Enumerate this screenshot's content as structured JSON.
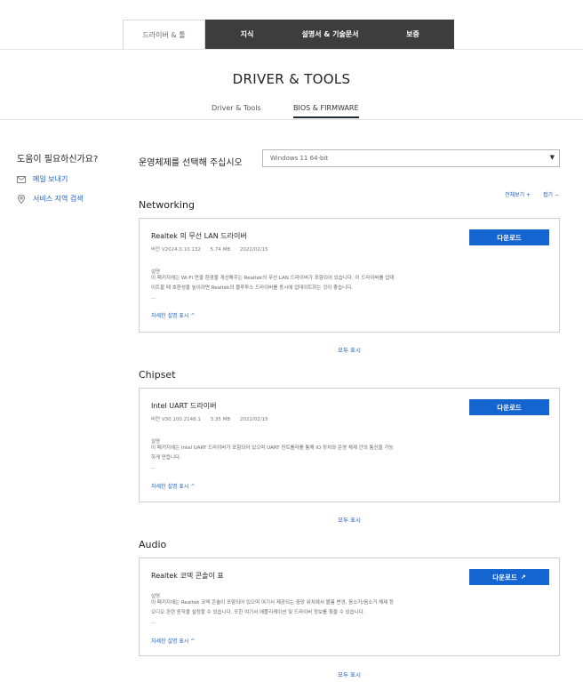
{
  "top_tabs": [
    "드라이버 & 툴",
    "지식",
    "설명서 & 기술문서",
    "보증"
  ],
  "page_title": "DRIVER & TOOLS",
  "sub_tabs": [
    "Driver & Tools",
    "BIOS & FIRMWARE"
  ],
  "help": {
    "title": "도움이 필요하신가요?",
    "email": "메일 보내기",
    "service_area": "서비스 지역 검색"
  },
  "os": {
    "label": "운영체제를 선택해 주십시오",
    "selected": "Windows 11 64-bit"
  },
  "expand_all": "전체보기 +",
  "collapse_all": "접기 −",
  "show_all": "모두 표시",
  "more_label": "자세한 설명 표시 ^",
  "desc_label": "설명",
  "ellipsis": "...",
  "sections": [
    {
      "title": "Networking",
      "item": {
        "name": "Realtek 의 무선 LAN 드라이버",
        "version": "버전 V2024.0.10.132",
        "size": "5.74 MB",
        "date": "2022/02/15",
        "desc_line1": "이 패키지에는 Wi-Fi 연결 환경을 개선해주는 Realtek의 무선 LAN 드라이버가 포함되어 있습니다. 이 드라이버를 업데",
        "desc_line2": "이트할 때 호환성을 높이려면 Realtek의 블루투스 드라이버를 동시에 업데이트하는 것이 좋습니다.",
        "button": "다운로드",
        "external": false
      }
    },
    {
      "title": "Chipset",
      "item": {
        "name": "Intel UART 드라이버",
        "version": "버전 V30.100.2148.1",
        "size": "3.35 MB",
        "date": "2022/02/15",
        "desc_line1": "이 패키지에는 Intel UART 드라이버가 포함되어 있으며 UART 컨트롤러를 통해 IO 장치와 운영 체제 간의 통신을 가능",
        "desc_line2": "하게 만듭니다.",
        "button": "다운로드",
        "external": false
      }
    },
    {
      "title": "Audio",
      "item": {
        "name": "Realtek 코덱 콘솔이 표",
        "version": "",
        "size": "",
        "date": "",
        "desc_line1": "이 패키지에는 Realtek 코덱 콘솔이 포함되어 있으며 여기서 제공되는 중앙 위치에서 볼륨 변경, 음소거/음소거 해제 등",
        "desc_line2": "오디오 관련 동작을 설정할 수 있습니다. 또한 여기서 애플리케이션 및 드라이버 정보를 찾을 수 있습니다.",
        "button": "다운로드",
        "external": true
      }
    }
  ]
}
